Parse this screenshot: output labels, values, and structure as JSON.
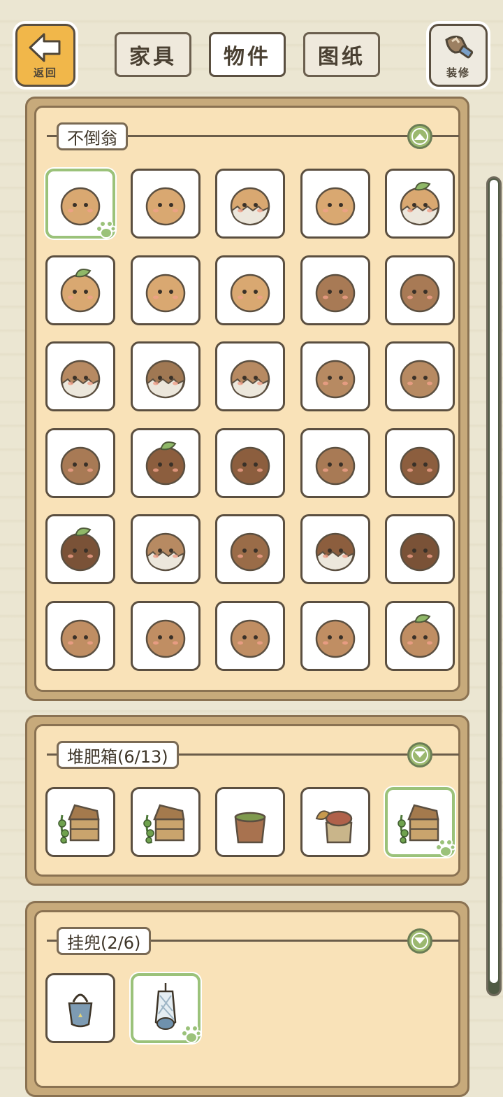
{
  "topbar": {
    "back_label": "返回",
    "decorate_label": "装修",
    "tabs": [
      {
        "label": "家具",
        "active": false
      },
      {
        "label": "物件",
        "active": true
      },
      {
        "label": "图纸",
        "active": false
      }
    ]
  },
  "sections": [
    {
      "title": "不倒翁",
      "expanded": true,
      "item_count": 30,
      "selected_index": 0
    },
    {
      "title": "堆肥箱(6/13)",
      "expanded": false,
      "item_count": 5,
      "selected_index": 4
    },
    {
      "title": "挂兜(2/6)",
      "expanded": false,
      "item_count": 2,
      "selected_index": 1
    }
  ],
  "colors": {
    "accent_orange": "#f1b74a",
    "panel_bg": "#f9e2b8",
    "panel_frame": "#c7aa7b",
    "selected_border": "#9bc27a",
    "collapse_green": "#9bb86f"
  },
  "icons": [
    "back-arrow-icon",
    "paint-brush-icon",
    "chevron-up-icon",
    "chevron-down-icon",
    "paw-icon",
    "daruma-icon",
    "compost-box-icon",
    "hanging-pouch-icon"
  ]
}
